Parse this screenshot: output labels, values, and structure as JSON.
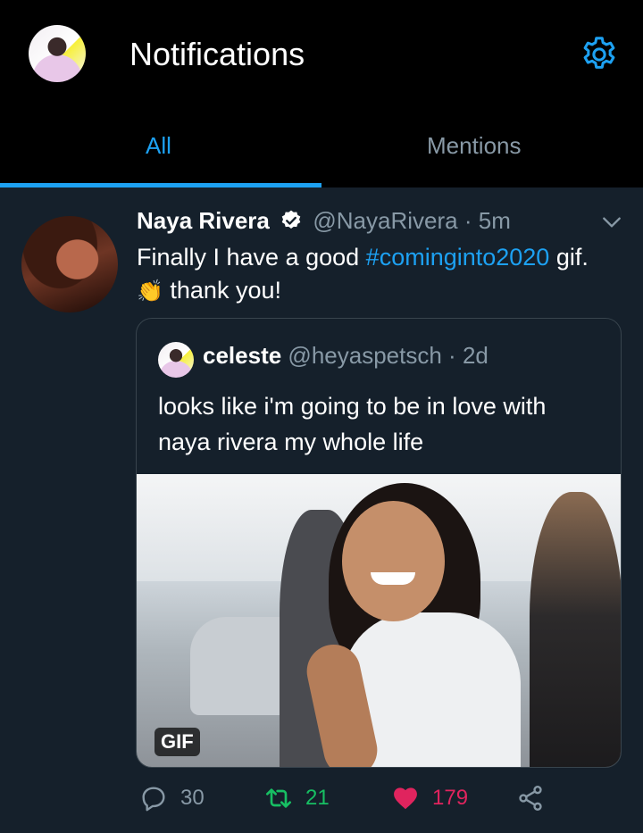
{
  "header": {
    "title": "Notifications",
    "tabs": [
      {
        "label": "All",
        "active": true
      },
      {
        "label": "Mentions",
        "active": false
      }
    ]
  },
  "tweet": {
    "author_name": "Naya Rivera",
    "author_handle": "@NayaRivera",
    "separator": "·",
    "time": "5m",
    "text_before": "Finally I have a good ",
    "hashtag": "#cominginto2020",
    "text_mid": " gif. ",
    "emoji": "👏",
    "text_after": " thank you!",
    "quote": {
      "author_name": "celeste",
      "author_handle": "@heyaspetsch",
      "separator": "·",
      "time": "2d",
      "text": "looks like i'm going to be in love with naya rivera my whole life",
      "media_badge": "GIF"
    },
    "counts": {
      "replies": "30",
      "retweets": "21",
      "likes": "179"
    }
  },
  "colors": {
    "background": "#15202b",
    "header": "#000000",
    "accent": "#1da1f2",
    "muted": "#8899a6",
    "retweet": "#17bf63",
    "like": "#e0245e",
    "border": "#38444d"
  },
  "icons": {
    "settings": "gear-icon",
    "verified": "verified-badge-icon",
    "more": "chevron-down-icon",
    "reply": "reply-icon",
    "retweet": "retweet-icon",
    "like": "heart-icon",
    "share": "share-icon"
  }
}
